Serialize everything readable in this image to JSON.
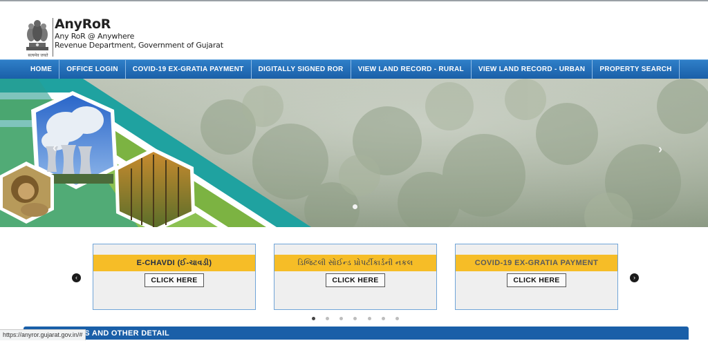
{
  "header": {
    "title": "AnyRoR",
    "subtitle1": "Any RoR @ Anywhere",
    "subtitle2": "Revenue Department, Government of Gujarat",
    "motto": "सत्यमेव जयते"
  },
  "nav": {
    "items": [
      "HOME",
      "OFFICE LOGIN",
      "COVID-19 EX-GRATIA PAYMENT",
      "DIGITALLY SIGNED ROR",
      "VIEW LAND RECORD - RURAL",
      "VIEW LAND RECORD - URBAN",
      "PROPERTY SEARCH"
    ]
  },
  "banner": {
    "prev_icon": "‹",
    "next_icon": "›",
    "icons": {
      "prev": "chevron-left-icon",
      "next": "chevron-right-icon"
    }
  },
  "cards": [
    {
      "title": "E-CHAVDI (ઈ-ચાવડી)",
      "button": "CLICK HERE"
    },
    {
      "title": "ડિજિટલી સોઈન્ડ પ્રોપર્ટીકાર્ડની નકલ",
      "button": "CLICK HERE"
    },
    {
      "title": "COVID-19 EX-GRATIA PAYMENT",
      "button": "CLICK HERE"
    }
  ],
  "carousel": {
    "prev_icon": "‹",
    "next_icon": "›"
  },
  "section": {
    "title": "RS AND OTHER DETAIL"
  },
  "status_bar": {
    "url": "https://anyror.gujarat.gov.in/#"
  },
  "colors": {
    "nav": "#1a5fa8",
    "card_head": "#f6bd27",
    "accent_green": "#7cb342",
    "accent_teal": "#1fa2a0"
  }
}
